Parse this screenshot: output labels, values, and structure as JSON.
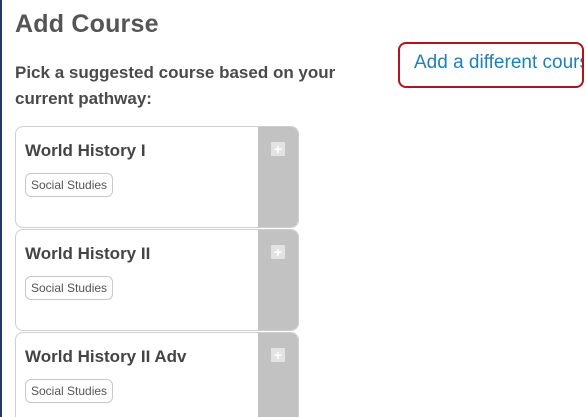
{
  "page": {
    "title": "Add Course",
    "subtitle": "Pick a suggested course based on your current pathway:",
    "different_course_link": "Add a different course"
  },
  "courses": [
    {
      "name": "World History I",
      "tag": "Social Studies",
      "add_icon": "plus-icon"
    },
    {
      "name": "World History II",
      "tag": "Social Studies",
      "add_icon": "plus-icon"
    },
    {
      "name": "World History II Adv",
      "tag": "Social Studies",
      "add_icon": "plus-icon"
    }
  ],
  "colors": {
    "background": "#1f3b63",
    "link": "#1f7fb8",
    "highlight_border": "#b0141c",
    "add_strip": "#c2c2c2"
  }
}
